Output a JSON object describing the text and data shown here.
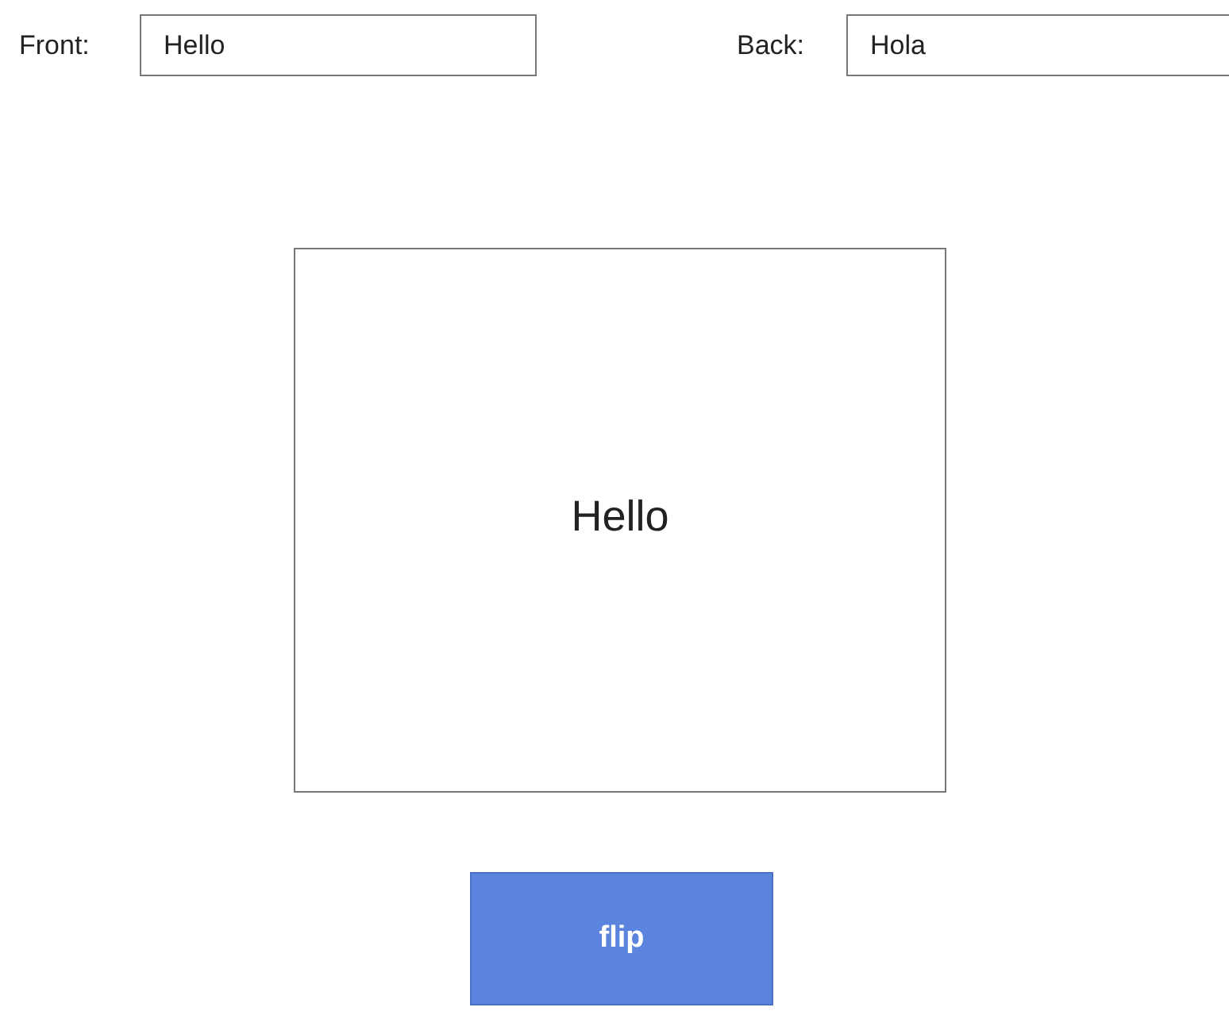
{
  "fields": [
    {
      "label": "Front:",
      "value": "Hello"
    },
    {
      "label": "Back:",
      "value": "Hola"
    }
  ],
  "card": {
    "text": "Hello"
  },
  "button": {
    "label": "flip"
  }
}
